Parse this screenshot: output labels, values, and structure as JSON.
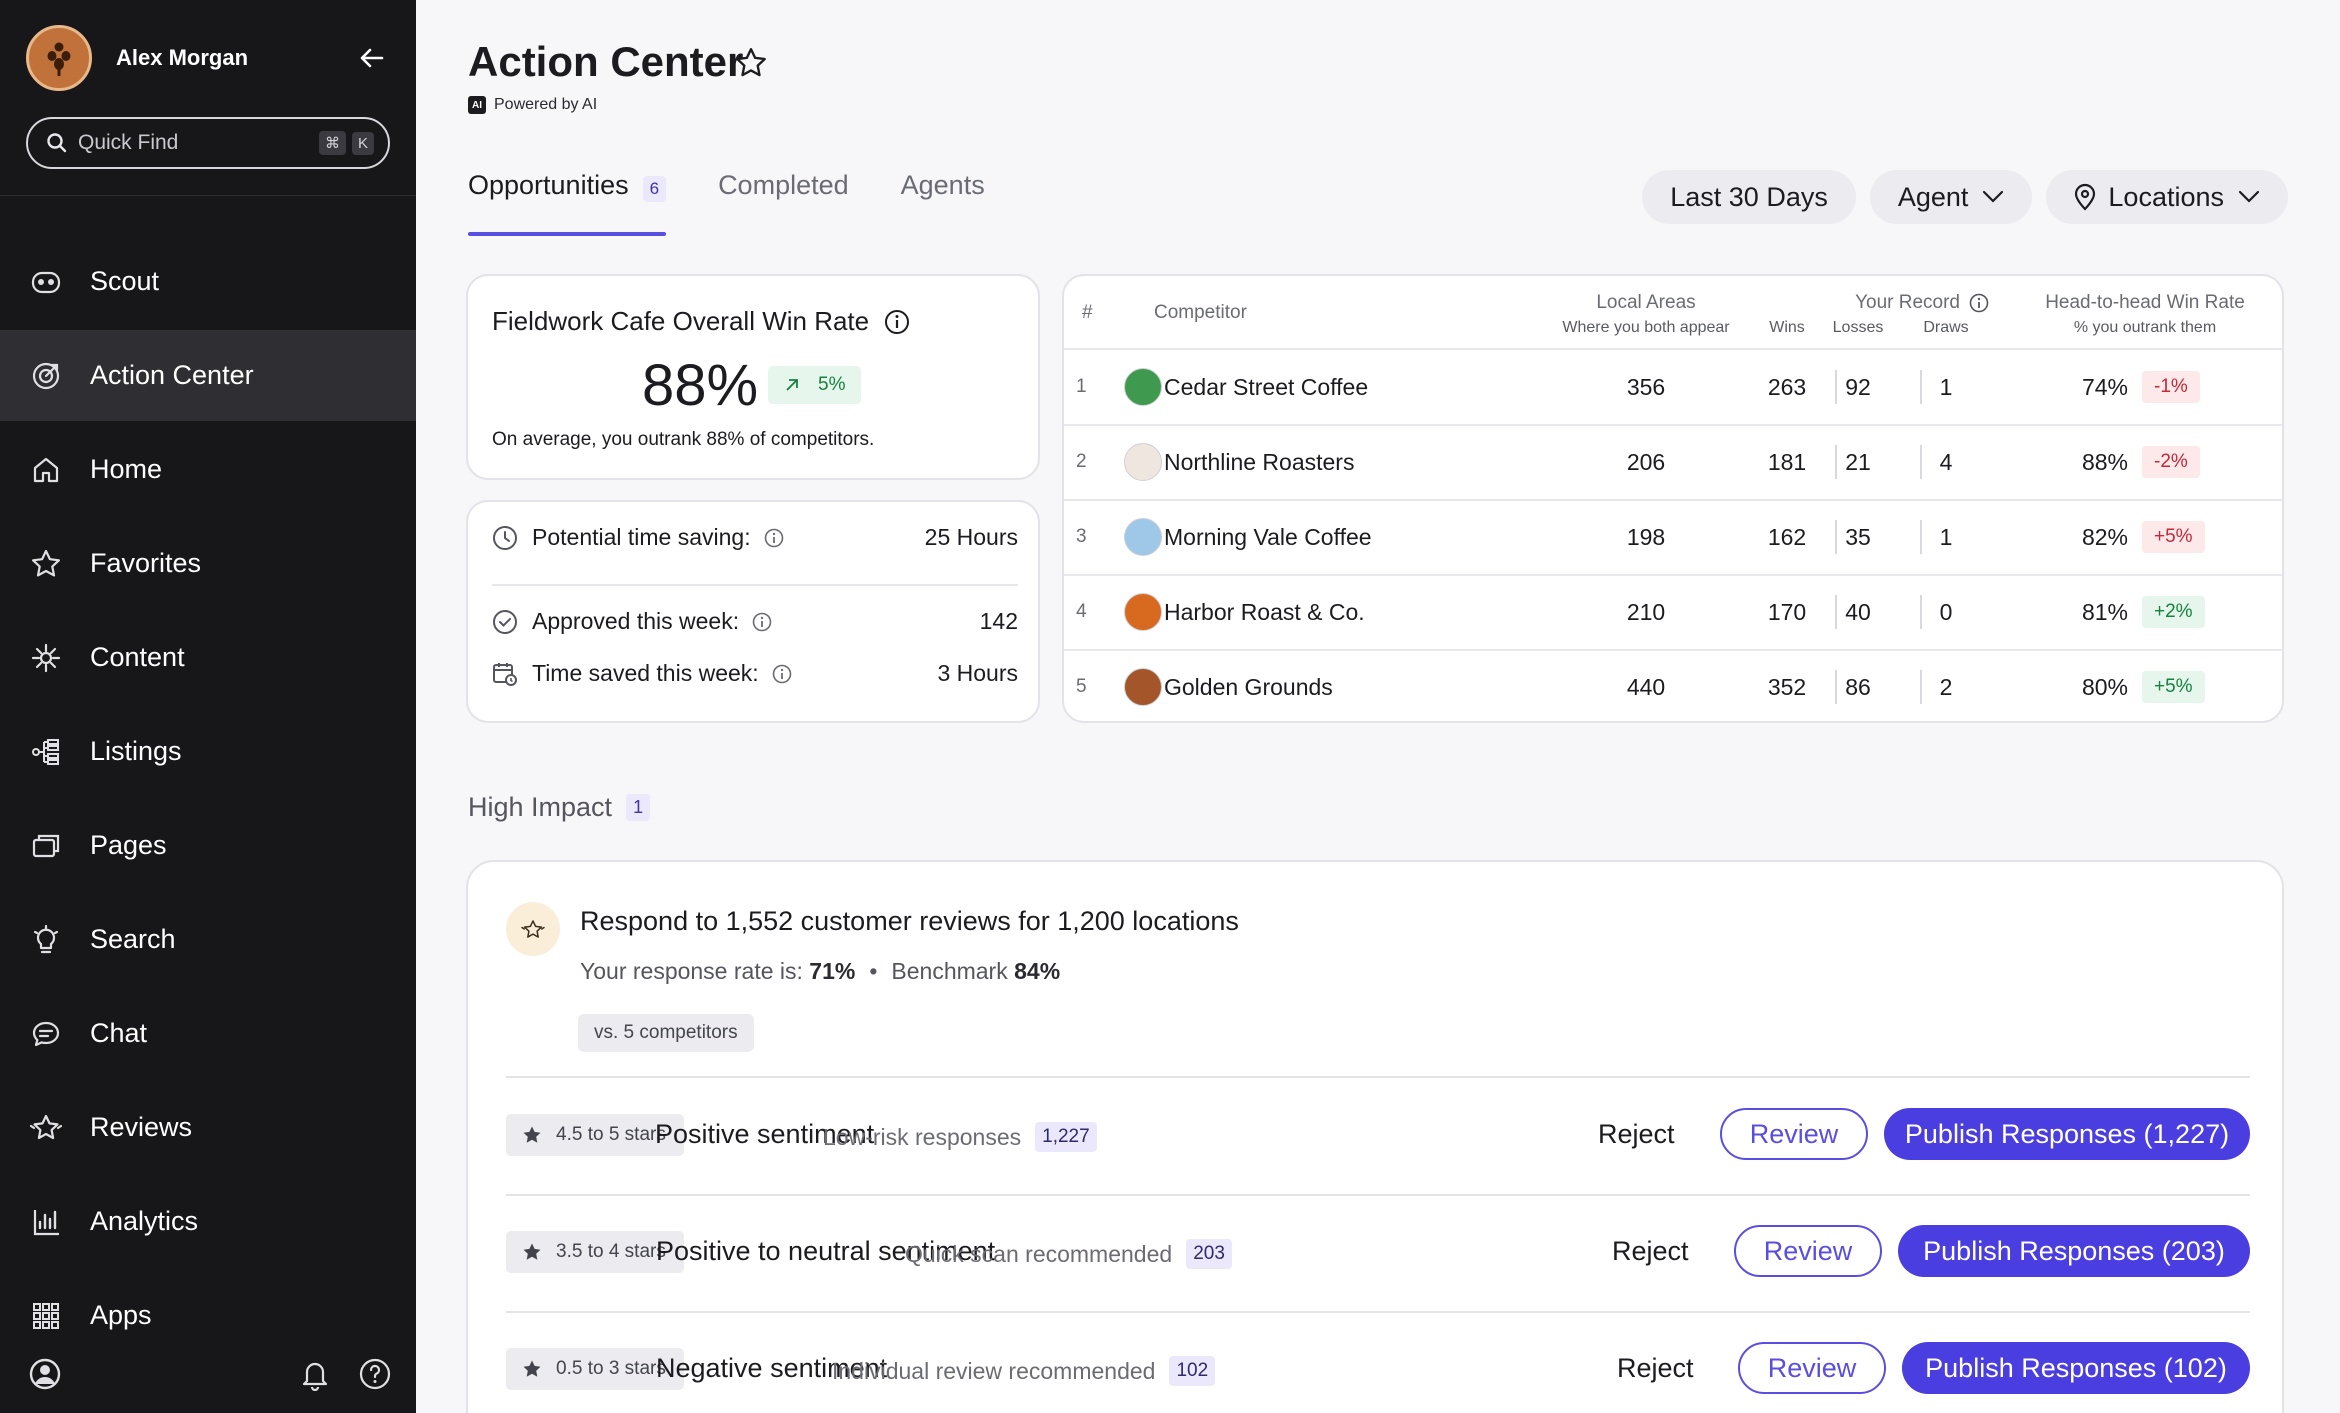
{
  "sidebar": {
    "user_name": "Alex Morgan",
    "quick_find_placeholder": "Quick Find",
    "shortcut_cmd": "⌘",
    "shortcut_key": "K",
    "items": [
      {
        "label": "Scout",
        "icon": "scout-icon"
      },
      {
        "label": "Action Center",
        "icon": "target-icon",
        "active": true
      },
      {
        "label": "Home",
        "icon": "home-icon"
      },
      {
        "label": "Favorites",
        "icon": "star-icon"
      },
      {
        "label": "Content",
        "icon": "content-icon"
      },
      {
        "label": "Listings",
        "icon": "listings-icon"
      },
      {
        "label": "Pages",
        "icon": "pages-icon"
      },
      {
        "label": "Search",
        "icon": "lightbulb-icon"
      },
      {
        "label": "Chat",
        "icon": "chat-icon"
      },
      {
        "label": "Reviews",
        "icon": "reviews-icon"
      },
      {
        "label": "Analytics",
        "icon": "analytics-icon"
      },
      {
        "label": "Apps",
        "icon": "apps-grid-icon"
      }
    ]
  },
  "header": {
    "title": "Action Center",
    "powered_badge": "AI",
    "powered_by": "Powered by AI"
  },
  "tabs": [
    {
      "label": "Opportunities",
      "count": "6",
      "active": true
    },
    {
      "label": "Completed"
    },
    {
      "label": "Agents"
    }
  ],
  "filters": {
    "date_range": "Last 30 Days",
    "agent": "Agent",
    "locations": "Locations"
  },
  "win_rate": {
    "title": "Fieldwork Cafe Overall Win Rate",
    "value": "88%",
    "trend": "5%",
    "note_prefix": "On average, you outrank ",
    "note_value": "88%",
    "note_suffix": " of competitors."
  },
  "savings": {
    "potential_label": "Potential time saving:",
    "potential_value": "25 Hours",
    "approved_label": "Approved this week:",
    "approved_value": "142",
    "saved_label": "Time saved this week:",
    "saved_value": "3 Hours"
  },
  "competitors": {
    "headers": {
      "rank": "#",
      "competitor": "Competitor",
      "local_areas": "Local Areas",
      "local_areas_sub": "Where you both appear",
      "your_record": "Your Record",
      "wins": "Wins",
      "losses": "Losses",
      "draws": "Draws",
      "h2h": "Head-to-head Win Rate",
      "h2h_sub": "% you outrank them"
    },
    "rows": [
      {
        "rank": "1",
        "name": "Cedar Street Coffee",
        "areas": "356",
        "wins": "263",
        "losses": "92",
        "draws": "1",
        "rate": "74%",
        "delta": "-1%",
        "delta_dir": "neg",
        "logo_color": "#3f9a4f"
      },
      {
        "rank": "2",
        "name": "Northline Roasters",
        "areas": "206",
        "wins": "181",
        "losses": "21",
        "draws": "4",
        "rate": "88%",
        "delta": "-2%",
        "delta_dir": "neg",
        "logo_color": "#efe7df"
      },
      {
        "rank": "3",
        "name": "Morning Vale Coffee",
        "areas": "198",
        "wins": "162",
        "losses": "35",
        "draws": "1",
        "rate": "82%",
        "delta": "+5%",
        "delta_dir": "neg",
        "logo_color": "#9fc7e8"
      },
      {
        "rank": "4",
        "name": "Harbor Roast & Co.",
        "areas": "210",
        "wins": "170",
        "losses": "40",
        "draws": "0",
        "rate": "81%",
        "delta": "+2%",
        "delta_dir": "pos",
        "logo_color": "#d76a1f"
      },
      {
        "rank": "5",
        "name": "Golden Grounds",
        "areas": "440",
        "wins": "352",
        "losses": "86",
        "draws": "2",
        "rate": "80%",
        "delta": "+5%",
        "delta_dir": "pos",
        "logo_color": "#a4552a"
      }
    ]
  },
  "high_impact": {
    "label": "High Impact",
    "count": "1",
    "title": "Respond to 1,552 customer reviews for 1,200 locations",
    "response_label": "Your response rate is: ",
    "response_value": "71%",
    "bullet": "•",
    "benchmark_label": "Benchmark ",
    "benchmark_value": "84%",
    "vs_chip": "vs. 5 competitors",
    "reject_label": "Reject",
    "review_label": "Review",
    "segments": [
      {
        "stars": "4.5 to 5 stars",
        "title": "Positive sentiment",
        "desc": "Low-risk responses",
        "count": "1,227",
        "publish": "Publish Responses (1,227)"
      },
      {
        "stars": "3.5 to 4 stars",
        "title": "Positive to neutral sentiment",
        "desc": "Quick scan recommended",
        "count": "203",
        "publish": "Publish Responses (203)"
      },
      {
        "stars": "0.5 to 3 stars",
        "title": "Negative sentiment",
        "desc": "Individual review recommended",
        "count": "102",
        "publish": "Publish Responses (102)"
      }
    ]
  },
  "colors": {
    "accent": "#4b3ee0",
    "sidebar_bg": "#17171a",
    "positive": "#17823f",
    "negative": "#c4293a"
  }
}
